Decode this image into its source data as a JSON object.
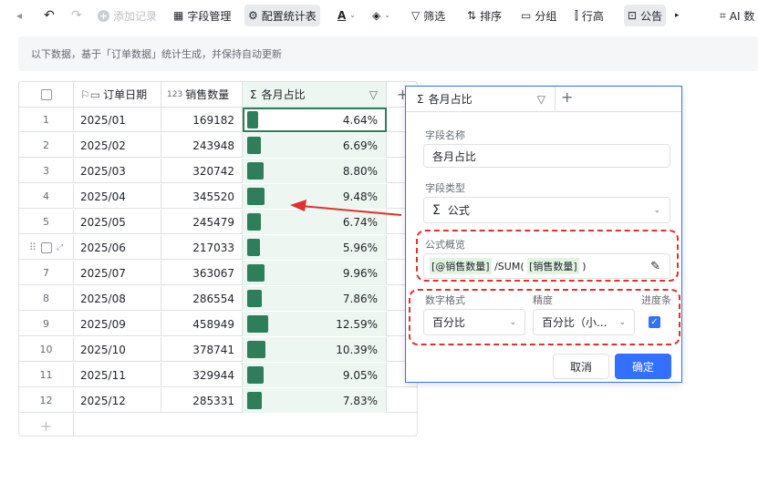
{
  "toolbar": {
    "add_record": "添加记录",
    "field_manage": "字段管理",
    "config_stats": "配置统计表",
    "filter": "筛选",
    "sort": "排序",
    "group": "分组",
    "row_height": "行高",
    "public": "公告",
    "ai": "AI 数"
  },
  "notice": "以下数据，基于「订单数据」统计生成，并保持自动更新",
  "grid": {
    "headers": {
      "date": "订单日期",
      "sales": "销售数量",
      "ratio": "各月占比"
    },
    "rows": [
      {
        "idx": "1",
        "date": "2025/01",
        "sales": "169182",
        "ratio": "4.64%",
        "pct": 4.64
      },
      {
        "idx": "2",
        "date": "2025/02",
        "sales": "243948",
        "ratio": "6.69%",
        "pct": 6.69
      },
      {
        "idx": "3",
        "date": "2025/03",
        "sales": "320742",
        "ratio": "8.80%",
        "pct": 8.8
      },
      {
        "idx": "4",
        "date": "2025/04",
        "sales": "345520",
        "ratio": "9.48%",
        "pct": 9.48
      },
      {
        "idx": "5",
        "date": "2025/05",
        "sales": "245479",
        "ratio": "6.74%",
        "pct": 6.74
      },
      {
        "idx": "",
        "date": "2025/06",
        "sales": "217033",
        "ratio": "5.96%",
        "pct": 5.96
      },
      {
        "idx": "7",
        "date": "2025/07",
        "sales": "363067",
        "ratio": "9.96%",
        "pct": 9.96
      },
      {
        "idx": "8",
        "date": "2025/08",
        "sales": "286554",
        "ratio": "7.86%",
        "pct": 7.86
      },
      {
        "idx": "9",
        "date": "2025/09",
        "sales": "458949",
        "ratio": "12.59%",
        "pct": 12.59
      },
      {
        "idx": "10",
        "date": "2025/10",
        "sales": "378741",
        "ratio": "10.39%",
        "pct": 10.39
      },
      {
        "idx": "11",
        "date": "2025/11",
        "sales": "329944",
        "ratio": "9.05%",
        "pct": 9.05
      },
      {
        "idx": "12",
        "date": "2025/12",
        "sales": "285331",
        "ratio": "7.83%",
        "pct": 7.83
      }
    ]
  },
  "panel": {
    "tab_label": "各月占比",
    "field_name_label": "字段名称",
    "field_name_value": "各月占比",
    "field_type_label": "字段类型",
    "field_type_value": "公式",
    "formula_label": "公式概览",
    "formula_ref1": "[@销售数量]",
    "formula_mid": " /SUM( ",
    "formula_ref2": "[销售数量]",
    "formula_end": " )",
    "num_format_label": "数字格式",
    "precision_label": "精度",
    "progress_label": "进度条",
    "num_format_value": "百分比",
    "precision_value": "百分比（小...",
    "cancel": "取消",
    "confirm": "确定"
  },
  "colors": {
    "accent": "#3370ff",
    "bar": "#2e7d5b",
    "annotation": "#e0302f"
  }
}
